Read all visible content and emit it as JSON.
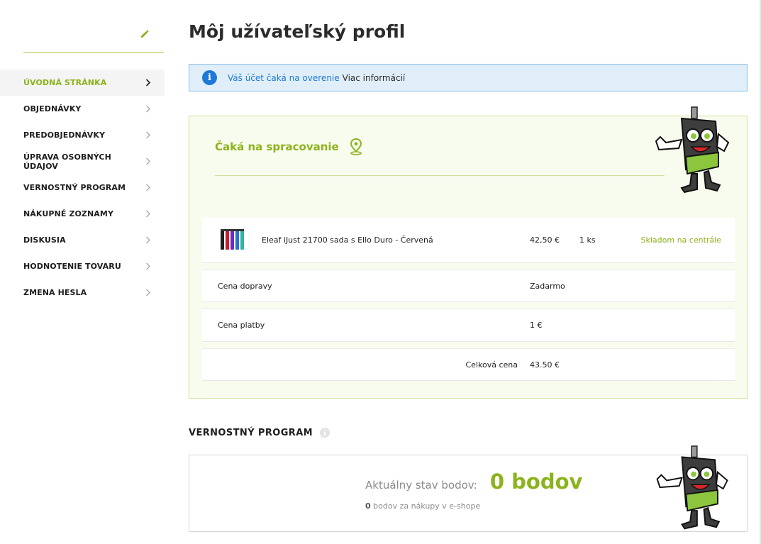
{
  "sidebar": {
    "items": [
      {
        "label": "ÚVODNÁ STRÁNKA"
      },
      {
        "label": "OBJEDNÁVKY"
      },
      {
        "label": "PREDOBJEDNÁVKY"
      },
      {
        "label": "ÚPRAVA OSOBNÝCH ÚDAJOV"
      },
      {
        "label": "VERNOSTNÝ PROGRAM"
      },
      {
        "label": "NÁKUPNÉ ZOZNAMY"
      },
      {
        "label": "DISKUSIA"
      },
      {
        "label": "HODNOTENIE TOVARU"
      },
      {
        "label": "ZMENA HESLA"
      }
    ],
    "icons": {
      "edit": "pencil-icon",
      "chevron": "chevron-right-icon"
    }
  },
  "page": {
    "title": "Môj užívateľský profil"
  },
  "alert": {
    "icon_glyph": "i",
    "message": "Váš účet čaká na overenie",
    "more_link": "Viac informácií"
  },
  "order": {
    "status": "Čaká na spracovanie",
    "product": {
      "name": "Eleaf iJust 21700 sada s Ello Duro - Červená",
      "price": "42,50 €",
      "qty": "1 ks",
      "stock": "Skladom na centrále"
    },
    "shipping": {
      "label": "Cena dopravy",
      "value": "Zadarmo"
    },
    "payment": {
      "label": "Cena platby",
      "value": "1 €"
    },
    "total": {
      "label": "Celková cena",
      "value": "43.50 €"
    }
  },
  "loyalty": {
    "title": "VERNOSTNÝ PROGRAM",
    "points_label": "Aktuálny stav bodov:",
    "points_value": "0 bodov",
    "sub_count": "0",
    "sub_text": " bodov za nákupy v e-shope"
  },
  "colors": {
    "accent": "#8bb31c",
    "info": "#1e78d6",
    "alert_bg": "#dfeef9",
    "order_bg": "#f8fcee"
  }
}
